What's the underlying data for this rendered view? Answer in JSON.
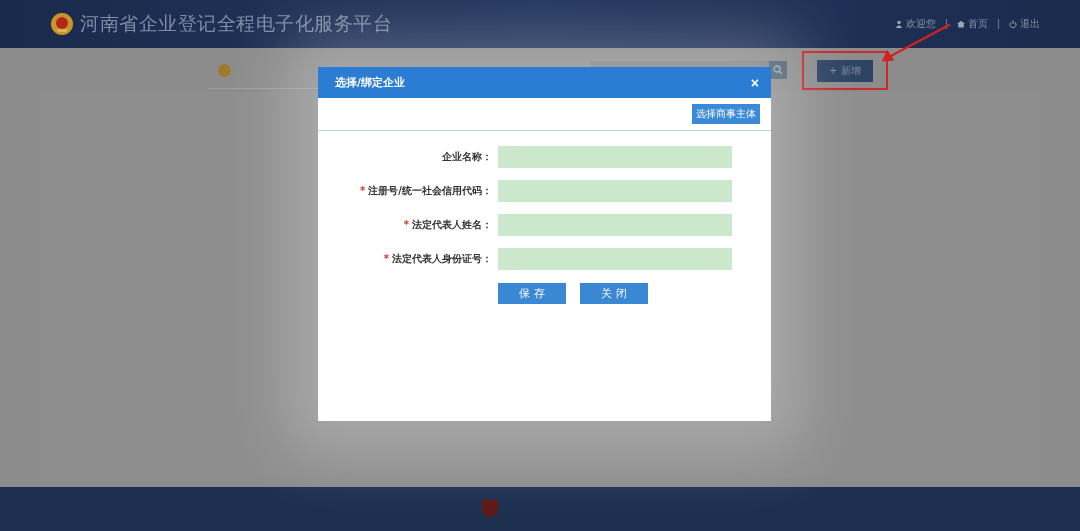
{
  "header": {
    "title": "河南省企业登记全程电子化服务平台",
    "links": [
      {
        "kind": "user",
        "label": "欢迎您"
      },
      {
        "kind": "home",
        "label": "首页"
      },
      {
        "kind": "logout",
        "label": "退出"
      }
    ]
  },
  "toolbar": {
    "add_button": "+ 新增",
    "highlighted": true
  },
  "dialog": {
    "title": "选择/绑定企业",
    "close": "×",
    "pick_button": "选择商事主体",
    "required_mark": "*",
    "fields": [
      {
        "label": "企业名称：",
        "required": false
      },
      {
        "label": "注册号/统一社会信用代码：",
        "required": true
      },
      {
        "label": "法定代表人姓名：",
        "required": true
      },
      {
        "label": "法定代表人身份证号：",
        "required": true
      }
    ],
    "buttons": [
      "保 存",
      "关 闭"
    ]
  }
}
